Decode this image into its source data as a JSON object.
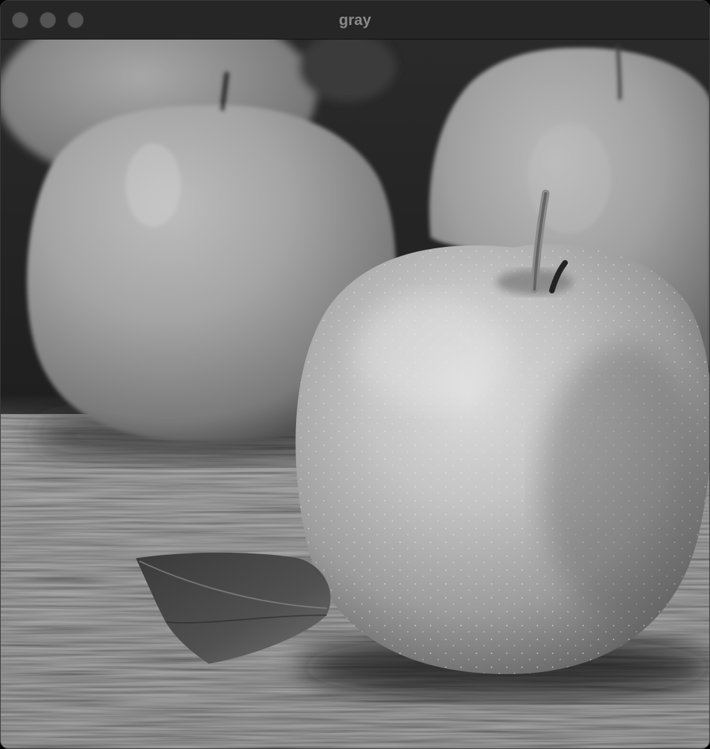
{
  "window": {
    "title": "gray",
    "traffic_lights": [
      "close-button",
      "minimize-button",
      "zoom-button"
    ]
  },
  "image": {
    "description_icon": "photo-icon"
  }
}
